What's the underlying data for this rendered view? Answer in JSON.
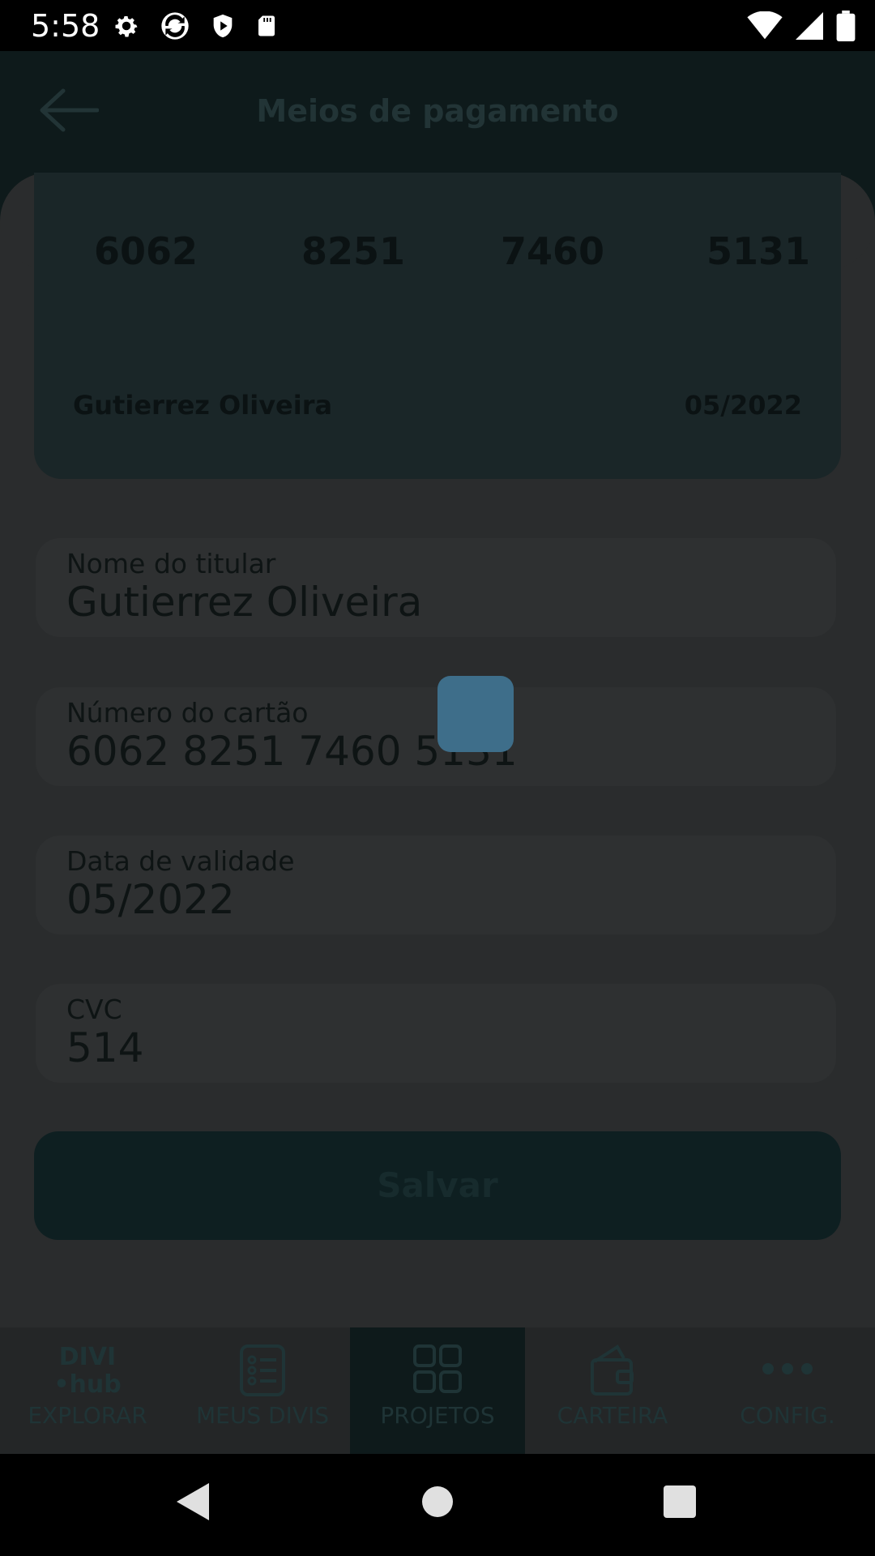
{
  "status_bar": {
    "time": "5:58"
  },
  "header": {
    "title": "Meios de pagamento"
  },
  "card_preview": {
    "digit_groups": [
      "6062",
      "8251",
      "7460",
      "5131"
    ],
    "holder_name": "Gutierrez Oliveira",
    "expiry": "05/2022"
  },
  "form": {
    "holder": {
      "label": "Nome do titular",
      "value": "Gutierrez Oliveira"
    },
    "number": {
      "label": "Número do cartão",
      "value": "6062 8251 7460 5131"
    },
    "expiry": {
      "label": "Data de validade",
      "value": "05/2022"
    },
    "cvc": {
      "label": "CVC",
      "value": "514"
    }
  },
  "save_button": {
    "label": "Salvar"
  },
  "bottom_nav": {
    "items": [
      {
        "label": "EXPLORAR",
        "icon": "divi-hub-logo-icon",
        "logo_text": "DIVI\n•hub"
      },
      {
        "label": "MEUS DIVIS",
        "icon": "list-icon"
      },
      {
        "label": "PROJETOS",
        "icon": "grid-icon",
        "active": true
      },
      {
        "label": "CARTEIRA",
        "icon": "wallet-icon"
      },
      {
        "label": "CONFIG.",
        "icon": "more-dots-icon"
      }
    ]
  },
  "colors": {
    "overlay_background": "#2a2c2d",
    "header": "#0e1a1b",
    "accent_square": "#3e6e8a"
  }
}
